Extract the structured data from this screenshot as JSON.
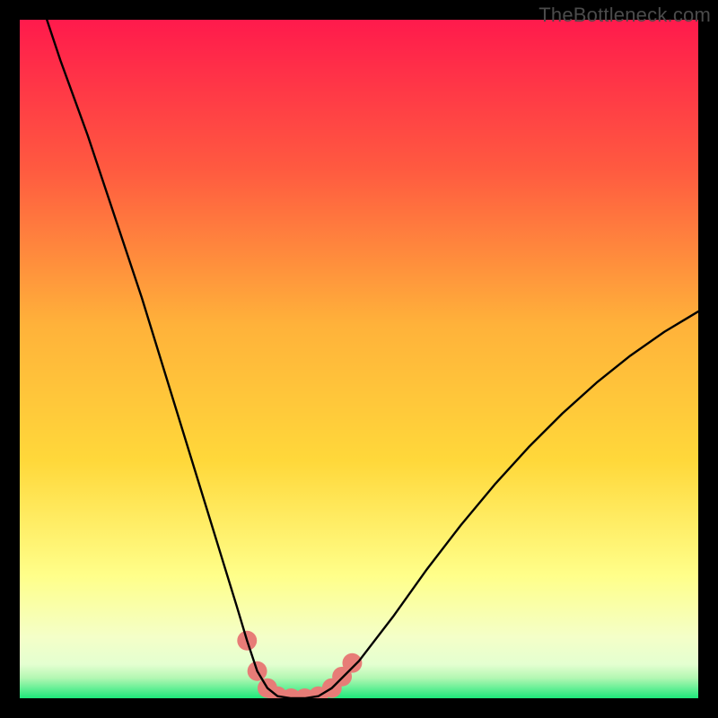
{
  "watermark": "TheBottleneck.com",
  "colors": {
    "black": "#000000",
    "gradient_top": "#ff1a4c",
    "gradient_mid_upper": "#ff7a3a",
    "gradient_mid": "#ffd83a",
    "gradient_mid_lower": "#ffff8a",
    "gradient_lower": "#f7ffd0",
    "gradient_bottom": "#1de87a",
    "curve": "#000000",
    "marker": "#e77c77"
  },
  "chart_data": {
    "type": "line",
    "title": "",
    "xlabel": "",
    "ylabel": "",
    "xlim": [
      0,
      100
    ],
    "ylim": [
      0,
      100
    ],
    "series": [
      {
        "name": "bottleneck-curve",
        "x": [
          4,
          6,
          8,
          10,
          12,
          14,
          16,
          18,
          20,
          22,
          24,
          26,
          28,
          30,
          32,
          33.5,
          35,
          36.5,
          38,
          40,
          42,
          44,
          46,
          50,
          55,
          60,
          65,
          70,
          75,
          80,
          85,
          90,
          95,
          100
        ],
        "y": [
          100,
          94,
          88.5,
          83,
          77,
          71,
          65,
          59,
          52.5,
          46,
          39.5,
          33,
          26.5,
          20,
          13.5,
          8.5,
          4,
          1.5,
          0.3,
          0,
          0,
          0.3,
          1.5,
          5.5,
          12,
          19,
          25.5,
          31.5,
          37,
          42,
          46.5,
          50.5,
          54,
          57
        ]
      }
    ],
    "markers": {
      "name": "bottom-band",
      "x": [
        33.5,
        35,
        36.5,
        38,
        40,
        42,
        44,
        46,
        47.5,
        49
      ],
      "y": [
        8.5,
        4,
        1.5,
        0.3,
        0,
        0,
        0.3,
        1.5,
        3.2,
        5.2
      ],
      "radius_pct": 1.45
    }
  }
}
